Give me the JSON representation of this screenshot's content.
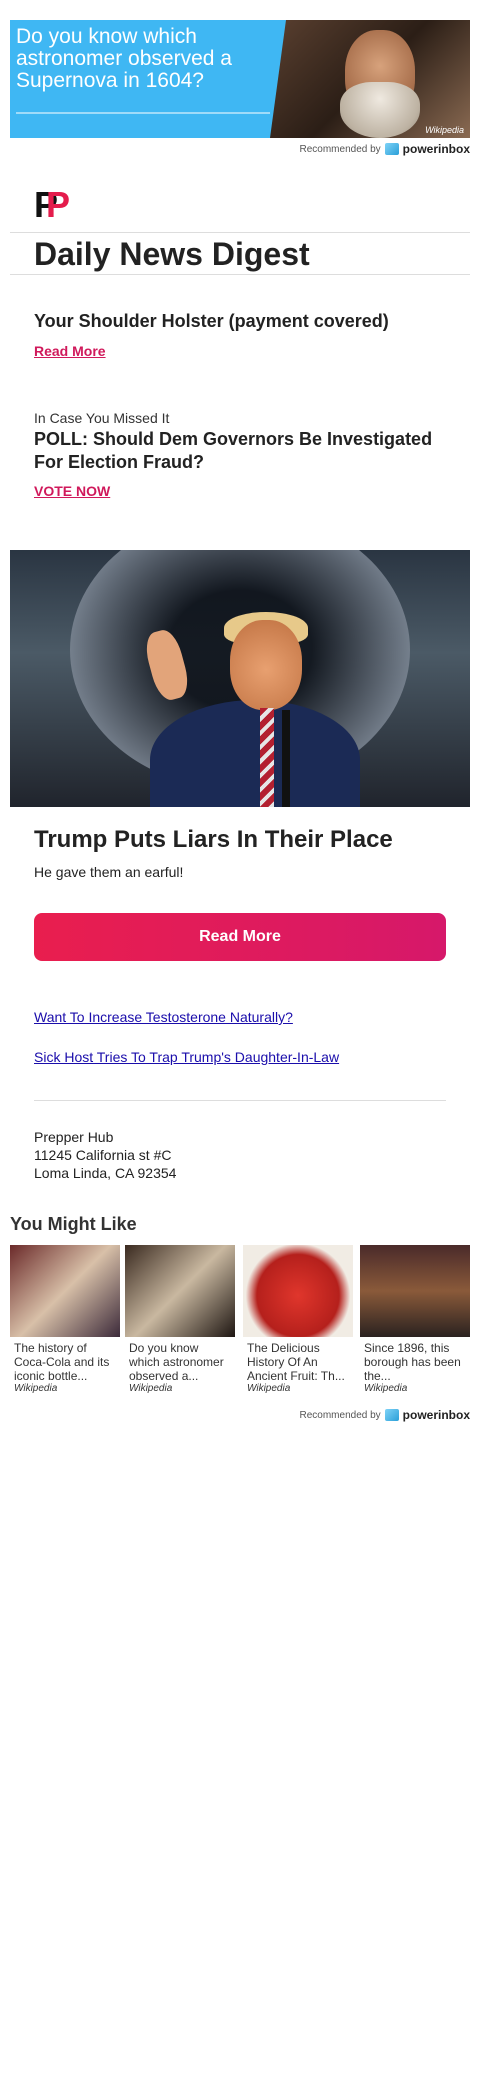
{
  "top_ad": {
    "headline": "Do you know which astronomer observed a Supernova in 1604?",
    "source": "Wikipedia",
    "recommended_by": "Recommended by",
    "brand": "powerinbox"
  },
  "header": {
    "logo_letters": [
      "P",
      "P"
    ],
    "title": "Daily News Digest"
  },
  "promo1": {
    "headline": "Your Shoulder Holster (payment covered)",
    "link": "Read More"
  },
  "poll": {
    "label": "In Case You Missed It",
    "headline": "POLL: Should Dem Governors Be Investigated For Election Fraud?",
    "link": "VOTE NOW"
  },
  "story": {
    "title": "Trump Puts Liars In Their Place",
    "subtitle": "He gave them an earful!",
    "cta": "Read More"
  },
  "links": [
    "Want To Increase Testosterone Naturally?",
    "Sick Host Tries To Trap Trump's Daughter-In-Law"
  ],
  "footer": {
    "name": "Prepper Hub",
    "address1": "11245 California st #C",
    "address2": "Loma Linda, CA 92354"
  },
  "you_might_like": {
    "title": "You Might Like",
    "items": [
      {
        "title": "The history of Coca-Cola and its iconic bottle...",
        "source": "Wikipedia"
      },
      {
        "title": "Do you know which astronomer observed a...",
        "source": "Wikipedia"
      },
      {
        "title": "The Delicious History Of An Ancient Fruit: Th...",
        "source": "Wikipedia"
      },
      {
        "title": "Since 1896, this borough has been the...",
        "source": "Wikipedia"
      }
    ],
    "recommended_by": "Recommended by",
    "brand": "powerinbox"
  },
  "colors": {
    "accent": "#e41c4c",
    "link_blue": "#1a0dab",
    "ad_blue": "#3fb7f3"
  }
}
